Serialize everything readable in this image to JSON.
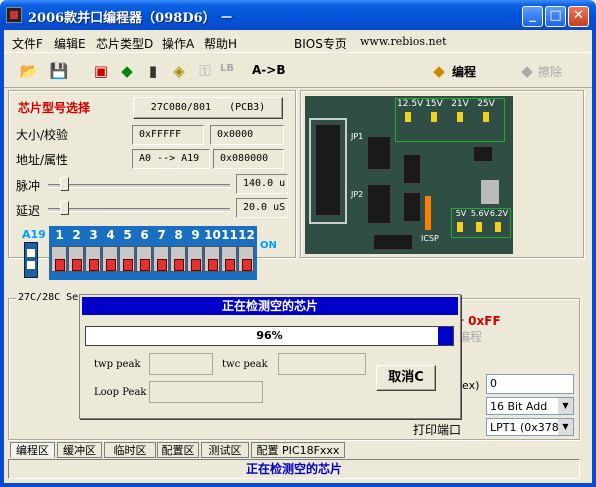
{
  "window": {
    "title": "2006款并口编程器（098D6） －",
    "min": "_",
    "max": "□",
    "close": "✕"
  },
  "menu": [
    "文件F",
    "编辑E",
    "芯片类型D",
    "操作A",
    "帮助H",
    "BIOS专页",
    "www.rebios.net"
  ],
  "toolbar": {
    "arrow_label": "A->B",
    "program_label": "编程",
    "erase_label": "擦除",
    "lb_label": "LB"
  },
  "chip": {
    "section_title": "芯片型号选择",
    "chip_button": "27C080/801   (PCB3)",
    "size_label": "大小/校验",
    "size_value": "0xFFFFF",
    "checksum_value": "0x0000",
    "addr_label": "地址/属性",
    "addr_range": "A0 --> A19",
    "addr_value": "0x080000",
    "pulse_label": "脉冲",
    "pulse_value": "140.0 u",
    "delay_label": "延迟",
    "delay_value": "20.0 uS"
  },
  "dip": {
    "a19": "A19",
    "numbers": [
      "1",
      "2",
      "3",
      "4",
      "5",
      "6",
      "7",
      "8",
      "9",
      "10",
      "11",
      "12"
    ],
    "on": "ON"
  },
  "board": {
    "volts_top": [
      "12.5V",
      "15V",
      "21V",
      "25V"
    ],
    "volts_bottom": [
      "5V",
      "5.6V",
      "6.2V"
    ],
    "jp1": "JP1",
    "jp2": "JP2",
    "icsp": "ICSP"
  },
  "lower": {
    "group_label": "27C/28C Se",
    "right_red": "号 0xFF",
    "right_gray": "编程",
    "ex_label": "ex)",
    "ex_value": "0",
    "mode_value": "16 Bit Add",
    "port_label": "打印端口",
    "port_value": "LPT1 (0x378)"
  },
  "dialog": {
    "title": "正在检测空的芯片",
    "progress": 0.96,
    "progress_text": "96%",
    "twp_label": "twp peak",
    "twc_label": "twc peak",
    "loop_label": "Loop Peak",
    "cancel_label": "取消C"
  },
  "tabs": [
    "编程区",
    "缓冲区",
    "临时区",
    "配置区",
    "测试区",
    "配置 PIC18Fxxx"
  ],
  "status": "正在检测空的芯片"
}
